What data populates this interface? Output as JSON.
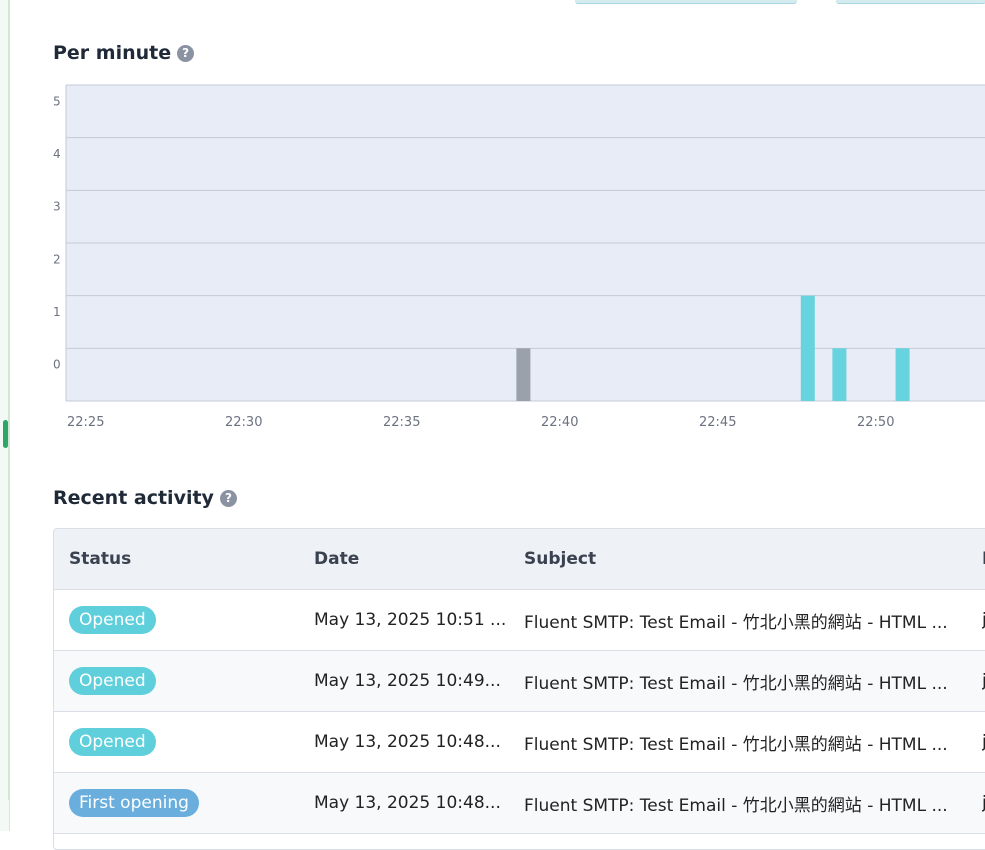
{
  "per_minute": {
    "title": "Per minute",
    "help_icon": "question-circle-icon"
  },
  "chart_data": {
    "type": "bar",
    "x_ticks": [
      "22:25",
      "22:30",
      "22:35",
      "22:40",
      "22:45",
      "22:50"
    ],
    "y_ticks": [
      "0",
      "1",
      "2",
      "3",
      "4",
      "5"
    ],
    "ylim": [
      0,
      5
    ],
    "grid": true,
    "series": [
      {
        "color": "#9ba1ab",
        "points": [
          {
            "x": "22:39",
            "value": 1
          }
        ]
      },
      {
        "color": "#67d3de",
        "points": [
          {
            "x": "22:48",
            "value": 2
          },
          {
            "x": "22:49",
            "value": 1
          },
          {
            "x": "22:51",
            "value": 1
          }
        ]
      }
    ]
  },
  "recent_activity": {
    "title": "Recent activity",
    "help_icon": "question-circle-icon",
    "columns": [
      "Status",
      "Date",
      "Subject",
      "I"
    ],
    "rows": [
      {
        "status": "Opened",
        "status_color": "#5fcfdc",
        "date": "May 13, 2025 10:51 ...",
        "subject": "Fluent SMTP: Test Email - 竹北小黑的網站 - HTML ...",
        "extra": "j"
      },
      {
        "status": "Opened",
        "status_color": "#5fcfdc",
        "date": "May 13, 2025 10:49...",
        "subject": "Fluent SMTP: Test Email - 竹北小黑的網站 - HTML ...",
        "extra": "j"
      },
      {
        "status": "Opened",
        "status_color": "#5fcfdc",
        "date": "May 13, 2025 10:48...",
        "subject": "Fluent SMTP: Test Email - 竹北小黑的網站 - HTML ...",
        "extra": "j"
      },
      {
        "status": "First opening",
        "status_color": "#6aaede",
        "date": "May 13, 2025 10:48...",
        "subject": "Fluent SMTP: Test Email - 竹北小黑的網站 - HTML ...",
        "extra": "j"
      }
    ]
  }
}
